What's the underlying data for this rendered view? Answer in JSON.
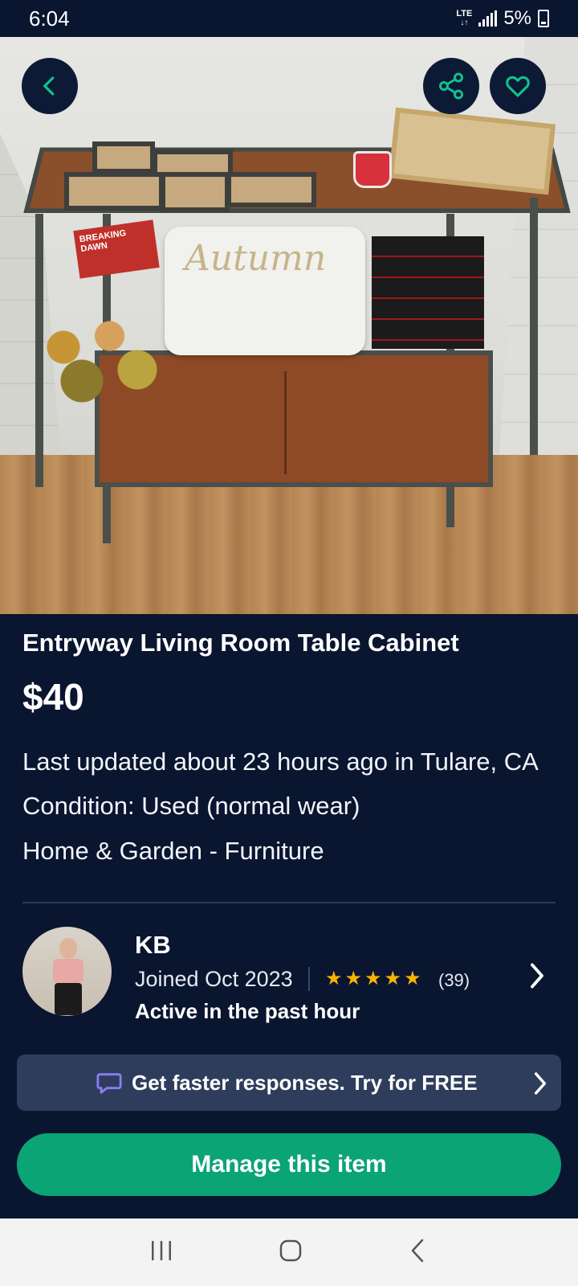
{
  "status_bar": {
    "time": "6:04",
    "network": "LTE",
    "battery": "5%"
  },
  "photo": {
    "pillow_text": "Autumn",
    "book_text": "BREAKING DAWN"
  },
  "actions": {
    "back_icon": "chevron-left-icon",
    "share_icon": "share-icon",
    "favorite_icon": "heart-icon"
  },
  "listing": {
    "title": "Entryway Living Room Table Cabinet",
    "price": "$40",
    "updated": "Last updated about 23 hours ago in Tulare, CA",
    "condition": "Condition: Used (normal wear)",
    "category": "Home & Garden - Furniture"
  },
  "seller": {
    "name": "KB",
    "joined": "Joined Oct 2023",
    "rating_stars": 5,
    "rating_count": "(39)",
    "active": "Active in the past hour"
  },
  "promo": {
    "text": "Get faster responses.  Try for FREE"
  },
  "manage_button": {
    "label": "Manage this item"
  },
  "colors": {
    "background": "#0a1530",
    "accent_green": "#0aa475",
    "promo_bg": "#2f3d5c",
    "star": "#f4b400",
    "chat_icon": "#8a7cf5"
  }
}
